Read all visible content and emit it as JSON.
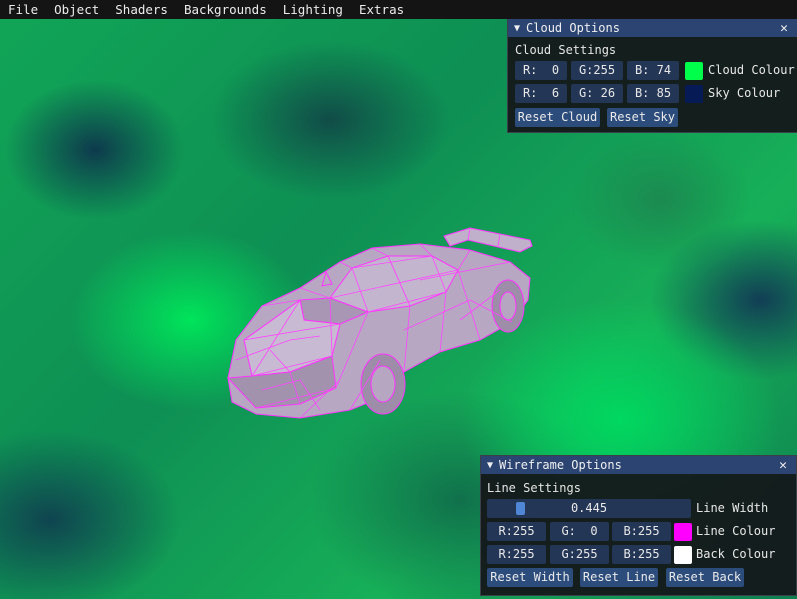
{
  "menu": [
    "File",
    "Object",
    "Shaders",
    "Backgrounds",
    "Lighting",
    "Extras"
  ],
  "cloud_panel": {
    "title": "Cloud Options",
    "section": "Cloud Settings",
    "cloud": {
      "r": "R:  0",
      "g": "G:255",
      "b": "B: 74",
      "label": "Cloud Colour",
      "color": "#00ff4a"
    },
    "sky": {
      "r": "R:  6",
      "g": "G: 26",
      "b": "B: 85",
      "label": "Sky Colour",
      "color": "#061a55"
    },
    "reset_cloud": "Reset Cloud",
    "reset_sky": "Reset Sky"
  },
  "wire_panel": {
    "title": "Wireframe Options",
    "section": "Line Settings",
    "line_width": {
      "value": "0.445",
      "fraction": 0.15,
      "label": "Line Width"
    },
    "line": {
      "r": "R:255",
      "g": "G:  0",
      "b": "B:255",
      "label": "Line Colour",
      "color": "#ff00ff"
    },
    "back": {
      "r": "R:255",
      "g": "G:255",
      "b": "B:255",
      "label": "Back Colour",
      "color": "#ffffff"
    },
    "reset_width": "Reset Width",
    "reset_line": "Reset Line",
    "reset_back": "Reset Back"
  }
}
